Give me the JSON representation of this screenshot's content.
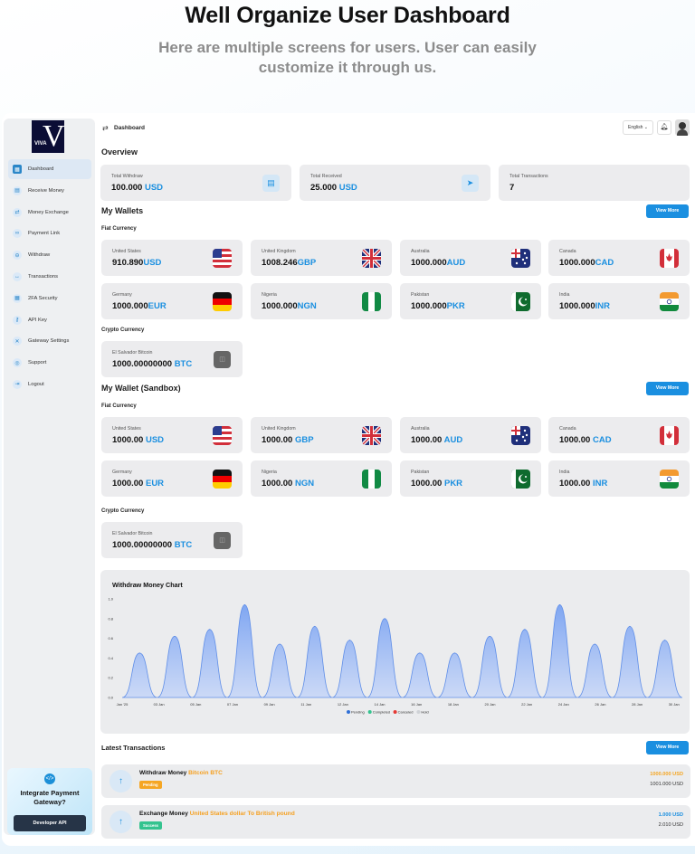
{
  "hero": {
    "title": "Well Organize User Dashboard",
    "subtitle": "Here are multiple screens for users. User can easily customize it through us."
  },
  "logo": {
    "letter": "V",
    "text": "VIVA"
  },
  "topbar": {
    "title": "Dashboard",
    "language": "English",
    "menu_icon": "swap-icon",
    "bell_icon": "bell-icon"
  },
  "sidebar": {
    "items": [
      {
        "label": "Dashboard",
        "icon": "dashboard-icon",
        "glyph": "▦",
        "active": true
      },
      {
        "label": "Receive Money",
        "icon": "receive-icon",
        "glyph": "▤",
        "active": false
      },
      {
        "label": "Money Exchange",
        "icon": "exchange-icon",
        "glyph": "⇄",
        "active": false
      },
      {
        "label": "Payment Link",
        "icon": "link-icon",
        "glyph": "∞",
        "active": false
      },
      {
        "label": "Withdraw",
        "icon": "withdraw-icon",
        "glyph": "⊖",
        "active": false
      },
      {
        "label": "Transactions",
        "icon": "transactions-icon",
        "glyph": "↔",
        "active": false
      },
      {
        "label": "2FA Security",
        "icon": "security-icon",
        "glyph": "▦",
        "active": false
      },
      {
        "label": "API Key",
        "icon": "key-icon",
        "glyph": "⚷",
        "active": false
      },
      {
        "label": "Gateway Settings",
        "icon": "settings-icon",
        "glyph": "✕",
        "active": false
      },
      {
        "label": "Support",
        "icon": "support-icon",
        "glyph": "◎",
        "active": false
      },
      {
        "label": "Logout",
        "icon": "logout-icon",
        "glyph": "⇥",
        "active": false
      }
    ],
    "promo": {
      "title": "Integrate Payment Gateway?",
      "button": "Developer API"
    }
  },
  "overview": {
    "title": "Overview",
    "cards": [
      {
        "label": "Total Withdraw",
        "amount": "100.000",
        "currency": "USD",
        "icon": "document-icon"
      },
      {
        "label": "Total Received",
        "amount": "25.000",
        "currency": "USD",
        "icon": "send-icon"
      },
      {
        "label": "Total Transactions",
        "amount": "7",
        "currency": "",
        "icon": ""
      }
    ]
  },
  "wallets": {
    "title": "My Wallets",
    "view_more": "View More",
    "fiat_title": "Fiat Currency",
    "fiat": [
      {
        "country": "United States",
        "amount": "910.890",
        "currency": "USD",
        "flag": "us"
      },
      {
        "country": "United Kingdom",
        "amount": "1008.246",
        "currency": "GBP",
        "flag": "uk"
      },
      {
        "country": "Australia",
        "amount": "1000.000",
        "currency": "AUD",
        "flag": "au"
      },
      {
        "country": "Canada",
        "amount": "1000.000",
        "currency": "CAD",
        "flag": "ca"
      },
      {
        "country": "Germany",
        "amount": "1000.000",
        "currency": "EUR",
        "flag": "de"
      },
      {
        "country": "Nigeria",
        "amount": "1000.000",
        "currency": "NGN",
        "flag": "ng"
      },
      {
        "country": "Pakistan",
        "amount": "1000.000",
        "currency": "PKR",
        "flag": "pk"
      },
      {
        "country": "India",
        "amount": "1000.000",
        "currency": "INR",
        "flag": "in"
      }
    ],
    "crypto_title": "Crypto Currency",
    "crypto": [
      {
        "name": "El Salvador Bitcoin",
        "amount": "1000.00000000",
        "currency": "BTC",
        "icon": "coin-icon"
      }
    ]
  },
  "sandbox": {
    "title": "My Wallet (Sandbox)",
    "view_more": "View More",
    "fiat_title": "Fiat Currency",
    "fiat": [
      {
        "country": "United States",
        "amount": "1000.00",
        "currency": "USD",
        "flag": "us"
      },
      {
        "country": "United Kingdom",
        "amount": "1000.00",
        "currency": "GBP",
        "flag": "uk"
      },
      {
        "country": "Australia",
        "amount": "1000.00",
        "currency": "AUD",
        "flag": "au"
      },
      {
        "country": "Canada",
        "amount": "1000.00",
        "currency": "CAD",
        "flag": "ca"
      },
      {
        "country": "Germany",
        "amount": "1000.00",
        "currency": "EUR",
        "flag": "de"
      },
      {
        "country": "Nigeria",
        "amount": "1000.00",
        "currency": "NGN",
        "flag": "ng"
      },
      {
        "country": "Pakistan",
        "amount": "1000.00",
        "currency": "PKR",
        "flag": "pk"
      },
      {
        "country": "India",
        "amount": "1000.00",
        "currency": "INR",
        "flag": "in"
      }
    ],
    "crypto_title": "Crypto Currency",
    "crypto": [
      {
        "name": "El Salvador Bitcoin",
        "amount": "1000.00000000",
        "currency": "BTC",
        "icon": "coin-icon"
      }
    ]
  },
  "chart_data": {
    "type": "area",
    "title": "Withdraw Money Chart",
    "ylim": [
      0,
      1
    ],
    "yticks": [
      "0.0",
      "0.2",
      "0.4",
      "0.6",
      "0.8",
      "1.0"
    ],
    "x_tick_labels": [
      "Jan '25",
      "03 Jan",
      "05 Jan",
      "07 Jan",
      "09 Jan",
      "11 Jan",
      "12 Jan",
      "14 Jan",
      "16 Jan",
      "18 Jan",
      "20 Jan",
      "22 Jan",
      "24 Jan",
      "26 Jan",
      "28 Jan",
      "30 Jan"
    ],
    "series": [
      {
        "name": "Pending",
        "color": "#2f6fd6",
        "values": [
          0.45,
          0.62,
          0.69,
          0.94,
          0.54,
          0.72,
          0.58,
          0.8,
          0.45,
          0.45,
          0.62,
          0.69,
          0.94,
          0.54,
          0.72,
          0.58
        ]
      }
    ],
    "legend": [
      {
        "name": "Pending",
        "color": "#2f6fd6"
      },
      {
        "name": "Completed",
        "color": "#34c38f"
      },
      {
        "name": "Canceled",
        "color": "#e53935"
      },
      {
        "name": "Hold",
        "color": "#cfd2d6"
      }
    ],
    "legend_position": "bottom",
    "grid": false
  },
  "transactions": {
    "title": "Latest Transactions",
    "view_more": "View More",
    "items": [
      {
        "title": "Withdraw Money",
        "detail": "Bitcoin BTC",
        "status": "Pending",
        "status_color": "#f5a623",
        "amount_primary": "1000.000 USD",
        "amount_color": "#f5a623",
        "amount_secondary": "1001.000 USD",
        "icon": "arrow-up-icon"
      },
      {
        "title": "Exchange Money",
        "detail": "United States dollar To British pound",
        "status": "Success",
        "status_color": "#34c38f",
        "amount_primary": "1.000 USD",
        "amount_color": "#1a8fe0",
        "amount_secondary": "2.010 USD",
        "icon": "arrow-up-icon"
      }
    ]
  }
}
